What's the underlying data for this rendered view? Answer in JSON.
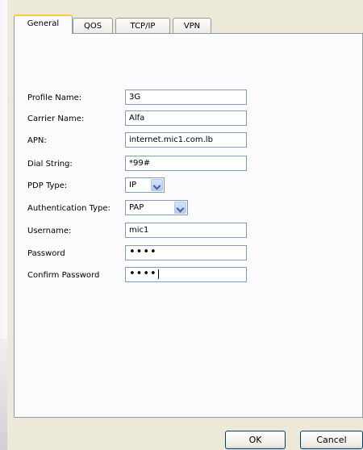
{
  "tabs": [
    {
      "label": "General"
    },
    {
      "label": "QOS"
    },
    {
      "label": "TCP/IP"
    },
    {
      "label": "VPN"
    }
  ],
  "form": {
    "profile_name": {
      "label": "Profile Name:",
      "value": "3G"
    },
    "carrier_name": {
      "label": "Carrier Name:",
      "value": "Alfa"
    },
    "apn": {
      "label": "APN:",
      "value": "internet.mic1.com.lb"
    },
    "dial_string": {
      "label": "Dial String:",
      "value": "*99#"
    },
    "pdp_type": {
      "label": "PDP Type:",
      "value": "IP"
    },
    "auth_type": {
      "label": "Authentication Type:",
      "value": "PAP"
    },
    "username": {
      "label": "Username:",
      "value": "mic1"
    },
    "password": {
      "label": "Password",
      "value": "••••"
    },
    "confirm_password": {
      "label": "Confirm Password",
      "value": "••••"
    }
  },
  "buttons": {
    "ok": "OK",
    "cancel": "Cancel"
  }
}
